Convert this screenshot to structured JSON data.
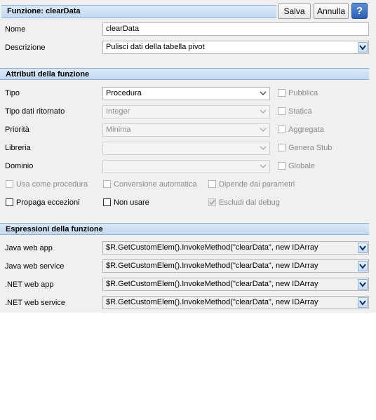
{
  "header": {
    "title": "Funzione: clearData",
    "save_label": "Salva",
    "cancel_label": "Annulla",
    "help_label": "?"
  },
  "general": {
    "name_label": "Nome",
    "name_value": "clearData",
    "description_label": "Descrizione",
    "description_value": "Pulisci dati della tabella pivot"
  },
  "attributes": {
    "section_title": "Attributi della funzione",
    "type_label": "Tipo",
    "type_value": "Procedura",
    "return_label": "Tipo dati ritornato",
    "return_value": "Integer",
    "priority_label": "Priorità",
    "priority_value": "Minima",
    "library_label": "Libreria",
    "library_value": "",
    "domain_label": "Dominio",
    "domain_value": "",
    "public_label": "Pubblica",
    "static_label": "Statica",
    "aggregate_label": "Aggregata",
    "stub_label": "Genera Stub",
    "global_label": "Globale",
    "use_as_proc_label": "Usa come procedura",
    "auto_conv_label": "Conversione automatica",
    "depends_label": "Dipende dai parametri",
    "propagate_label": "Propaga eccezioni",
    "not_use_label": "Non usare",
    "exclude_debug_label": "Escludi dal debug"
  },
  "expressions": {
    "section_title": "Espressioni della funzione",
    "rows": [
      {
        "label": "Java web app",
        "value": "$R.GetCustomElem().InvokeMethod(\"clearData\", new IDArray"
      },
      {
        "label": "Java web service",
        "value": "$R.GetCustomElem().InvokeMethod(\"clearData\", new IDArray"
      },
      {
        "label": ".NET web app",
        "value": "$R.GetCustomElem().InvokeMethod(\"clearData\", new IDArray"
      },
      {
        "label": ".NET web service",
        "value": "$R.GetCustomElem().InvokeMethod(\"clearData\", new IDArray"
      }
    ]
  },
  "icons": {
    "help": "help-icon",
    "dropdown": "chevron-down-icon",
    "check": "check-icon"
  },
  "colors": {
    "section_bar": "#c3daf2",
    "help_button": "#2a5fb4"
  }
}
